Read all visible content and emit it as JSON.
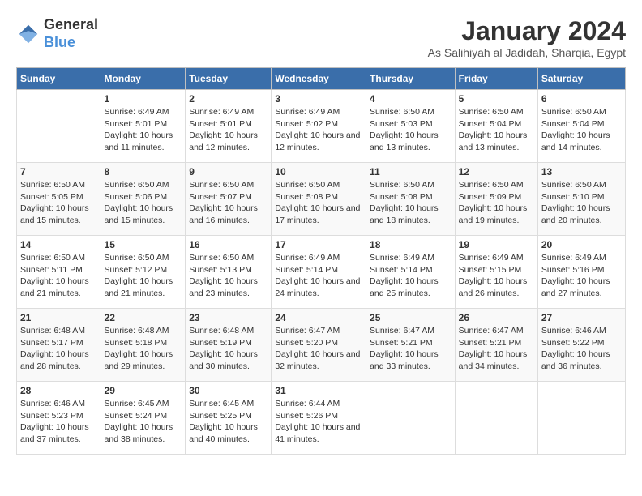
{
  "header": {
    "logo_general": "General",
    "logo_blue": "Blue",
    "month_title": "January 2024",
    "location": "As Salihiyah al Jadidah, Sharqia, Egypt"
  },
  "days_of_week": [
    "Sunday",
    "Monday",
    "Tuesday",
    "Wednesday",
    "Thursday",
    "Friday",
    "Saturday"
  ],
  "weeks": [
    [
      {
        "day": "",
        "sunrise": "",
        "sunset": "",
        "daylight": ""
      },
      {
        "day": "1",
        "sunrise": "6:49 AM",
        "sunset": "5:01 PM",
        "daylight": "10 hours and 11 minutes."
      },
      {
        "day": "2",
        "sunrise": "6:49 AM",
        "sunset": "5:01 PM",
        "daylight": "10 hours and 12 minutes."
      },
      {
        "day": "3",
        "sunrise": "6:49 AM",
        "sunset": "5:02 PM",
        "daylight": "10 hours and 12 minutes."
      },
      {
        "day": "4",
        "sunrise": "6:50 AM",
        "sunset": "5:03 PM",
        "daylight": "10 hours and 13 minutes."
      },
      {
        "day": "5",
        "sunrise": "6:50 AM",
        "sunset": "5:04 PM",
        "daylight": "10 hours and 13 minutes."
      },
      {
        "day": "6",
        "sunrise": "6:50 AM",
        "sunset": "5:04 PM",
        "daylight": "10 hours and 14 minutes."
      }
    ],
    [
      {
        "day": "7",
        "sunrise": "6:50 AM",
        "sunset": "5:05 PM",
        "daylight": "10 hours and 15 minutes."
      },
      {
        "day": "8",
        "sunrise": "6:50 AM",
        "sunset": "5:06 PM",
        "daylight": "10 hours and 15 minutes."
      },
      {
        "day": "9",
        "sunrise": "6:50 AM",
        "sunset": "5:07 PM",
        "daylight": "10 hours and 16 minutes."
      },
      {
        "day": "10",
        "sunrise": "6:50 AM",
        "sunset": "5:08 PM",
        "daylight": "10 hours and 17 minutes."
      },
      {
        "day": "11",
        "sunrise": "6:50 AM",
        "sunset": "5:08 PM",
        "daylight": "10 hours and 18 minutes."
      },
      {
        "day": "12",
        "sunrise": "6:50 AM",
        "sunset": "5:09 PM",
        "daylight": "10 hours and 19 minutes."
      },
      {
        "day": "13",
        "sunrise": "6:50 AM",
        "sunset": "5:10 PM",
        "daylight": "10 hours and 20 minutes."
      }
    ],
    [
      {
        "day": "14",
        "sunrise": "6:50 AM",
        "sunset": "5:11 PM",
        "daylight": "10 hours and 21 minutes."
      },
      {
        "day": "15",
        "sunrise": "6:50 AM",
        "sunset": "5:12 PM",
        "daylight": "10 hours and 21 minutes."
      },
      {
        "day": "16",
        "sunrise": "6:50 AM",
        "sunset": "5:13 PM",
        "daylight": "10 hours and 23 minutes."
      },
      {
        "day": "17",
        "sunrise": "6:49 AM",
        "sunset": "5:14 PM",
        "daylight": "10 hours and 24 minutes."
      },
      {
        "day": "18",
        "sunrise": "6:49 AM",
        "sunset": "5:14 PM",
        "daylight": "10 hours and 25 minutes."
      },
      {
        "day": "19",
        "sunrise": "6:49 AM",
        "sunset": "5:15 PM",
        "daylight": "10 hours and 26 minutes."
      },
      {
        "day": "20",
        "sunrise": "6:49 AM",
        "sunset": "5:16 PM",
        "daylight": "10 hours and 27 minutes."
      }
    ],
    [
      {
        "day": "21",
        "sunrise": "6:48 AM",
        "sunset": "5:17 PM",
        "daylight": "10 hours and 28 minutes."
      },
      {
        "day": "22",
        "sunrise": "6:48 AM",
        "sunset": "5:18 PM",
        "daylight": "10 hours and 29 minutes."
      },
      {
        "day": "23",
        "sunrise": "6:48 AM",
        "sunset": "5:19 PM",
        "daylight": "10 hours and 30 minutes."
      },
      {
        "day": "24",
        "sunrise": "6:47 AM",
        "sunset": "5:20 PM",
        "daylight": "10 hours and 32 minutes."
      },
      {
        "day": "25",
        "sunrise": "6:47 AM",
        "sunset": "5:21 PM",
        "daylight": "10 hours and 33 minutes."
      },
      {
        "day": "26",
        "sunrise": "6:47 AM",
        "sunset": "5:21 PM",
        "daylight": "10 hours and 34 minutes."
      },
      {
        "day": "27",
        "sunrise": "6:46 AM",
        "sunset": "5:22 PM",
        "daylight": "10 hours and 36 minutes."
      }
    ],
    [
      {
        "day": "28",
        "sunrise": "6:46 AM",
        "sunset": "5:23 PM",
        "daylight": "10 hours and 37 minutes."
      },
      {
        "day": "29",
        "sunrise": "6:45 AM",
        "sunset": "5:24 PM",
        "daylight": "10 hours and 38 minutes."
      },
      {
        "day": "30",
        "sunrise": "6:45 AM",
        "sunset": "5:25 PM",
        "daylight": "10 hours and 40 minutes."
      },
      {
        "day": "31",
        "sunrise": "6:44 AM",
        "sunset": "5:26 PM",
        "daylight": "10 hours and 41 minutes."
      },
      {
        "day": "",
        "sunrise": "",
        "sunset": "",
        "daylight": ""
      },
      {
        "day": "",
        "sunrise": "",
        "sunset": "",
        "daylight": ""
      },
      {
        "day": "",
        "sunrise": "",
        "sunset": "",
        "daylight": ""
      }
    ]
  ]
}
